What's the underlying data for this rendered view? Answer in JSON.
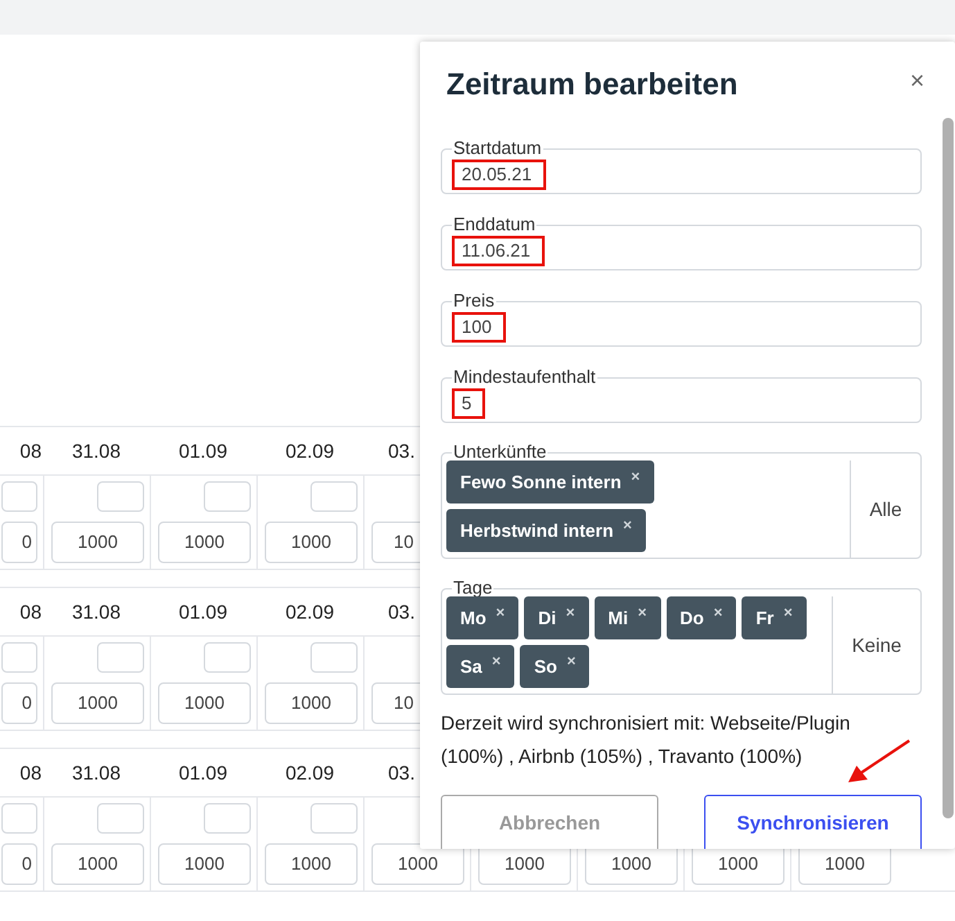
{
  "calendar": {
    "blocks": [
      {
        "dates": [
          "08",
          "31.08",
          "01.09",
          "02.09",
          "03."
        ],
        "values": [
          "0",
          "1000",
          "1000",
          "1000",
          "10"
        ]
      },
      {
        "dates": [
          "08",
          "31.08",
          "01.09",
          "02.09",
          "03."
        ],
        "values": [
          "0",
          "1000",
          "1000",
          "1000",
          "10"
        ]
      },
      {
        "dates": [
          "08",
          "31.08",
          "01.09",
          "02.09",
          "03."
        ],
        "values": [
          "0",
          "1000",
          "1000",
          "1000",
          "1000",
          "1000",
          "1000",
          "1000",
          "1000"
        ]
      }
    ]
  },
  "dialog": {
    "title": "Zeitraum bearbeiten",
    "close": "×",
    "fields": [
      {
        "label": "Startdatum",
        "value": "20.05.21",
        "highlighted": true
      },
      {
        "label": "Enddatum",
        "value": "11.06.21",
        "highlighted": true
      },
      {
        "label": "Preis",
        "value": "100",
        "highlighted": true
      },
      {
        "label": "Mindestaufenthalt",
        "value": "5",
        "highlighted": true
      }
    ],
    "tag_groups": [
      {
        "label": "Unterkünfte",
        "action": "Alle",
        "tags": [
          "Fewo Sonne intern",
          "Herbstwind intern"
        ]
      },
      {
        "label": "Tage",
        "action": "Keine",
        "tags": [
          "Mo",
          "Di",
          "Mi",
          "Do",
          "Fr",
          "Sa",
          "So"
        ]
      }
    ],
    "tag_remove": "×",
    "sync_note": "Derzeit wird synchronisiert mit: Webseite/Plugin (100%) , Airbnb (105%) , Travanto (100%)",
    "annotation_arrow": true,
    "buttons": [
      {
        "label": "Abbrechen",
        "kind": "secondary"
      },
      {
        "label": "Synchronisieren",
        "kind": "primary"
      }
    ]
  }
}
